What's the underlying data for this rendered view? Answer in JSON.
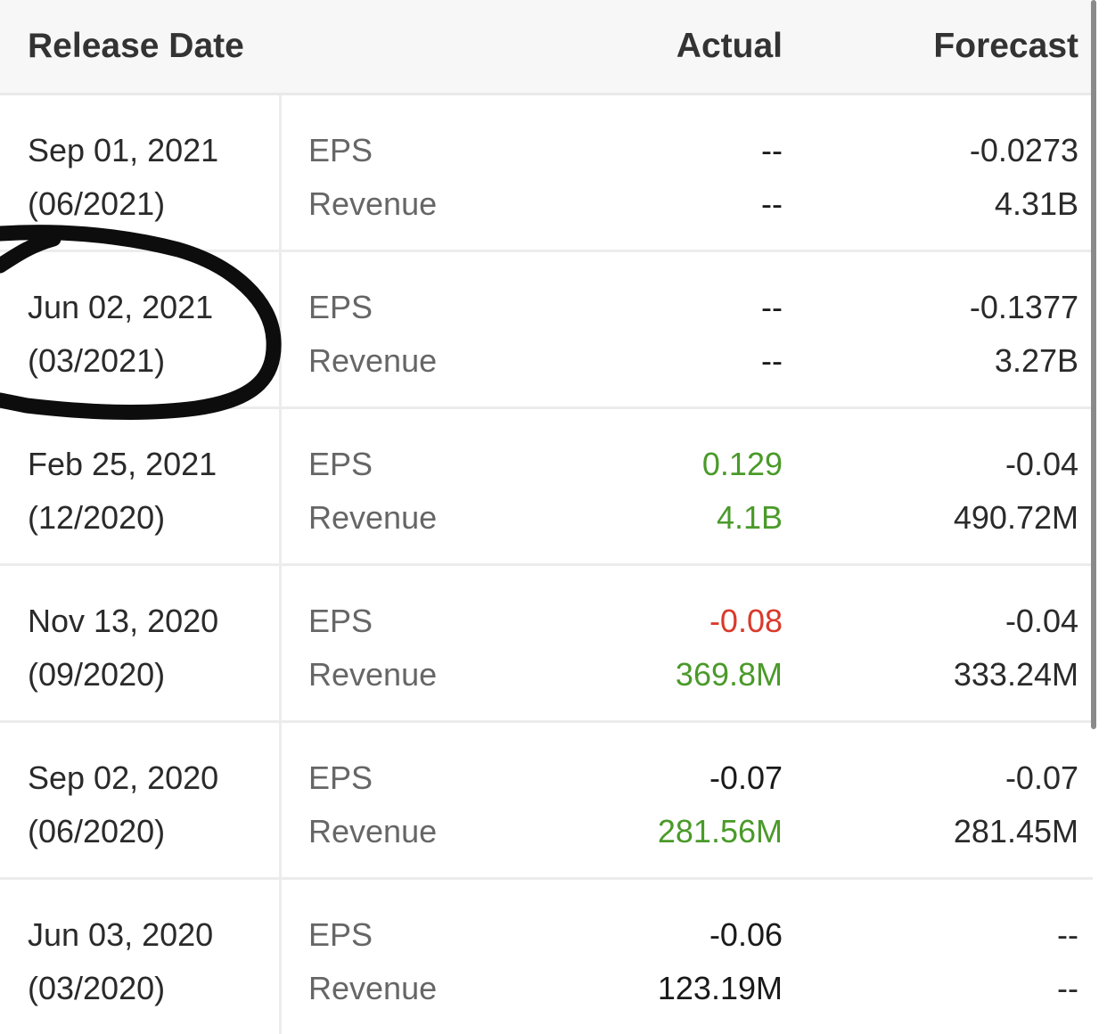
{
  "headers": {
    "release_date": "Release Date",
    "actual": "Actual",
    "forecast": "Forecast"
  },
  "colors": {
    "positive": "#4a9a2a",
    "negative": "#d93a2b",
    "neutral": "#1a1a1a",
    "annotation": "#0d0d0d"
  },
  "rows": [
    {
      "date": "Sep 01, 2021",
      "period": "(06/2021)",
      "metric1": "EPS",
      "metric2": "Revenue",
      "actual1": "--",
      "actual1_status": "neutral",
      "actual2": "--",
      "actual2_status": "neutral",
      "forecast1": "-0.0273",
      "forecast2": "4.31B"
    },
    {
      "date": "Jun 02, 2021",
      "period": "(03/2021)",
      "metric1": "EPS",
      "metric2": "Revenue",
      "actual1": "--",
      "actual1_status": "neutral",
      "actual2": "--",
      "actual2_status": "neutral",
      "forecast1": "-0.1377",
      "forecast2": "3.27B"
    },
    {
      "date": "Feb 25, 2021",
      "period": "(12/2020)",
      "metric1": "EPS",
      "metric2": "Revenue",
      "actual1": "0.129",
      "actual1_status": "positive",
      "actual2": "4.1B",
      "actual2_status": "positive",
      "forecast1": "-0.04",
      "forecast2": "490.72M"
    },
    {
      "date": "Nov 13, 2020",
      "period": "(09/2020)",
      "metric1": "EPS",
      "metric2": "Revenue",
      "actual1": "-0.08",
      "actual1_status": "negative",
      "actual2": "369.8M",
      "actual2_status": "positive",
      "forecast1": "-0.04",
      "forecast2": "333.24M"
    },
    {
      "date": "Sep 02, 2020",
      "period": "(06/2020)",
      "metric1": "EPS",
      "metric2": "Revenue",
      "actual1": "-0.07",
      "actual1_status": "neutral",
      "actual2": "281.56M",
      "actual2_status": "positive",
      "forecast1": "-0.07",
      "forecast2": "281.45M"
    },
    {
      "date": "Jun 03, 2020",
      "period": "(03/2020)",
      "metric1": "EPS",
      "metric2": "Revenue",
      "actual1": "-0.06",
      "actual1_status": "neutral",
      "actual2": "123.19M",
      "actual2_status": "neutral",
      "forecast1": "--",
      "forecast2": "--"
    }
  ]
}
